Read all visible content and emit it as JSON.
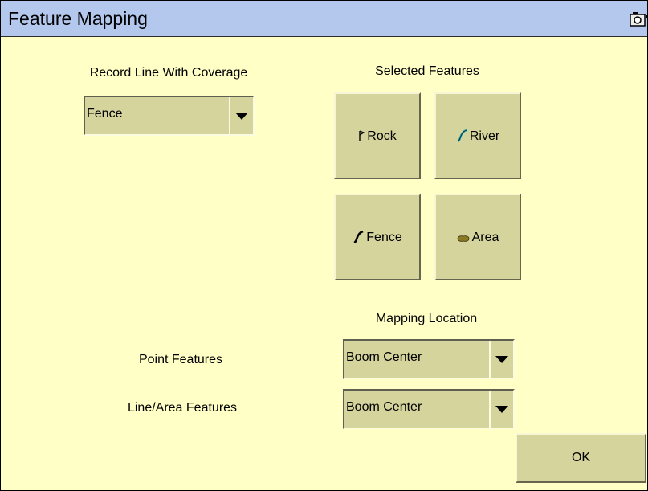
{
  "window": {
    "title": "Feature Mapping"
  },
  "record_line": {
    "label": "Record Line With Coverage",
    "selected": "Fence"
  },
  "selected_features": {
    "heading": "Selected Features",
    "items": [
      {
        "label": "Rock",
        "icon": "flag-icon"
      },
      {
        "label": "River",
        "icon": "river-line-icon",
        "color": "#1a9db0"
      },
      {
        "label": "Fence",
        "icon": "fence-line-icon",
        "color": "#000000"
      },
      {
        "label": "Area",
        "icon": "area-blob-icon",
        "color": "#7a6a1f"
      }
    ]
  },
  "mapping_location": {
    "heading": "Mapping Location",
    "point_label": "Point Features",
    "point_value": "Boom Center",
    "line_label": "Line/Area Features",
    "line_value": "Boom Center"
  },
  "ok_label": "OK",
  "colors": {
    "titlebar": "#b4c8ee",
    "background": "#ffffc6",
    "button": "#d5d49d"
  }
}
